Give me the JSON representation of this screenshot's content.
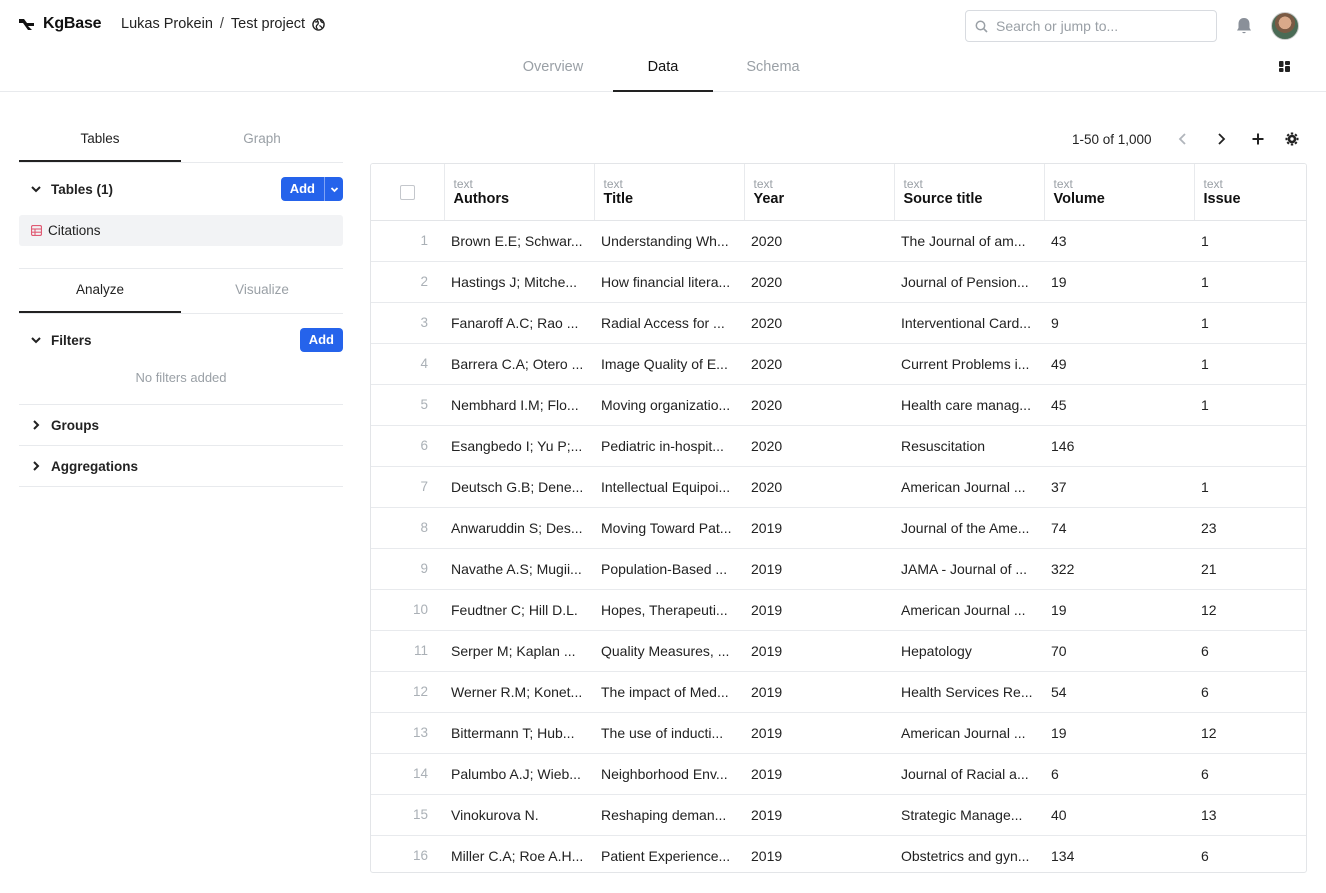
{
  "app": {
    "name": "KgBase"
  },
  "breadcrumb": {
    "owner": "Lukas Prokein",
    "separator": "/",
    "project": "Test project"
  },
  "search": {
    "placeholder": "Search or jump to..."
  },
  "page_tabs": [
    {
      "label": "Overview",
      "active": false
    },
    {
      "label": "Data",
      "active": true
    },
    {
      "label": "Schema",
      "active": false
    }
  ],
  "left_panel": {
    "tabs": [
      {
        "label": "Tables",
        "active": true
      },
      {
        "label": "Graph",
        "active": false
      }
    ],
    "tables_section": {
      "title": "Tables (1)",
      "add_label": "Add",
      "items": [
        "Citations"
      ]
    },
    "analyze_tabs": [
      {
        "label": "Analyze",
        "active": true
      },
      {
        "label": "Visualize",
        "active": false
      }
    ],
    "filters": {
      "title": "Filters",
      "add_label": "Add",
      "empty_text": "No filters added"
    },
    "groups": {
      "title": "Groups"
    },
    "aggregations": {
      "title": "Aggregations"
    }
  },
  "toolbar": {
    "pagination": "1-50 of 1,000"
  },
  "table": {
    "columns": [
      {
        "type": "text",
        "name": "Authors"
      },
      {
        "type": "text",
        "name": "Title"
      },
      {
        "type": "text",
        "name": "Year"
      },
      {
        "type": "text",
        "name": "Source title"
      },
      {
        "type": "text",
        "name": "Volume"
      },
      {
        "type": "text",
        "name": "Issue"
      }
    ],
    "rows": [
      [
        "1",
        "Brown E.E; Schwar...",
        "Understanding Wh...",
        "2020",
        "The Journal of am...",
        "43",
        "1"
      ],
      [
        "2",
        "Hastings J; Mitche...",
        "How financial litera...",
        "2020",
        "Journal of Pension...",
        "19",
        "1"
      ],
      [
        "3",
        "Fanaroff A.C; Rao ...",
        "Radial Access for ...",
        "2020",
        "Interventional Card...",
        "9",
        "1"
      ],
      [
        "4",
        "Barrera C.A; Otero ...",
        "Image Quality of E...",
        "2020",
        "Current Problems i...",
        "49",
        "1"
      ],
      [
        "5",
        "Nembhard I.M; Flo...",
        "Moving organizatio...",
        "2020",
        "Health care manag...",
        "45",
        "1"
      ],
      [
        "6",
        "Esangbedo I; Yu P;...",
        "Pediatric in-hospit...",
        "2020",
        "Resuscitation",
        "146",
        ""
      ],
      [
        "7",
        "Deutsch G.B; Dene...",
        "Intellectual Equipoi...",
        "2020",
        "American Journal ...",
        "37",
        "1"
      ],
      [
        "8",
        "Anwaruddin S; Des...",
        "Moving Toward Pat...",
        "2019",
        "Journal of the Ame...",
        "74",
        "23"
      ],
      [
        "9",
        "Navathe A.S; Mugii...",
        "Population-Based ...",
        "2019",
        "JAMA - Journal of ...",
        "322",
        "21"
      ],
      [
        "10",
        "Feudtner C; Hill D.L.",
        "Hopes, Therapeuti...",
        "2019",
        "American Journal ...",
        "19",
        "12"
      ],
      [
        "11",
        "Serper M; Kaplan ...",
        "Quality Measures, ...",
        "2019",
        "Hepatology",
        "70",
        "6"
      ],
      [
        "12",
        "Werner R.M; Konet...",
        "The impact of Med...",
        "2019",
        "Health Services Re...",
        "54",
        "6"
      ],
      [
        "13",
        "Bittermann T; Hub...",
        "The use of inducti...",
        "2019",
        "American Journal ...",
        "19",
        "12"
      ],
      [
        "14",
        "Palumbo A.J; Wieb...",
        "Neighborhood Env...",
        "2019",
        "Journal of Racial a...",
        "6",
        "6"
      ],
      [
        "15",
        "Vinokurova N.",
        "Reshaping deman...",
        "2019",
        "Strategic Manage...",
        "40",
        "13"
      ],
      [
        "16",
        "Miller C.A; Roe A.H...",
        "Patient Experience...",
        "2019",
        "Obstetrics and gyn...",
        "134",
        "6"
      ]
    ]
  },
  "colors": {
    "accent": "#2563eb",
    "table_icon": "#e05a73"
  }
}
